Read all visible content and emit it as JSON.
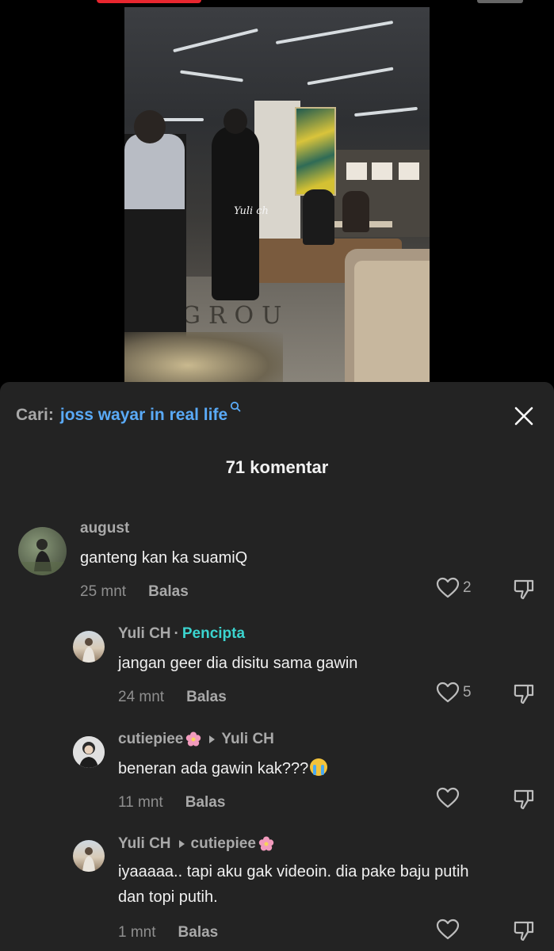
{
  "video": {
    "watermark": "Yuli ch",
    "floor_text": "GROU"
  },
  "search": {
    "prefix": "Cari:",
    "query": "joss wayar in real life"
  },
  "comments_header": {
    "count_label": "71 komentar"
  },
  "comments": [
    {
      "user": "august",
      "text": "ganteng kan ka suamiQ",
      "time": "25 mnt",
      "reply_label": "Balas",
      "likes": "2"
    },
    {
      "user": "Yuli CH",
      "badge": "Pencipta",
      "text": "jangan geer dia disitu sama gawin",
      "time": "24 mnt",
      "reply_label": "Balas",
      "likes": "5"
    },
    {
      "user": "cutiepiee",
      "reply_to": "Yuli CH",
      "text": "beneran ada gawin kak???",
      "time": "11 mnt",
      "reply_label": "Balas",
      "likes": ""
    },
    {
      "user": "Yuli CH",
      "reply_to": "cutiepiee",
      "text_line1": "iyaaaaa.. tapi aku gak videoin. dia pake baju putih",
      "text_line2": "dan topi putih.",
      "time": "1 mnt",
      "reply_label": "Balas",
      "likes": ""
    }
  ],
  "colors": {
    "sheet_bg": "#232323",
    "search_query": "#5aaaf7",
    "creator_badge": "#3bd4cf",
    "top_progress": "#e8262f"
  },
  "icons": [
    "search-icon",
    "close-icon",
    "heart-icon",
    "dislike-icon",
    "flower-emoji",
    "crying-emoji",
    "reply-arrow-icon"
  ]
}
